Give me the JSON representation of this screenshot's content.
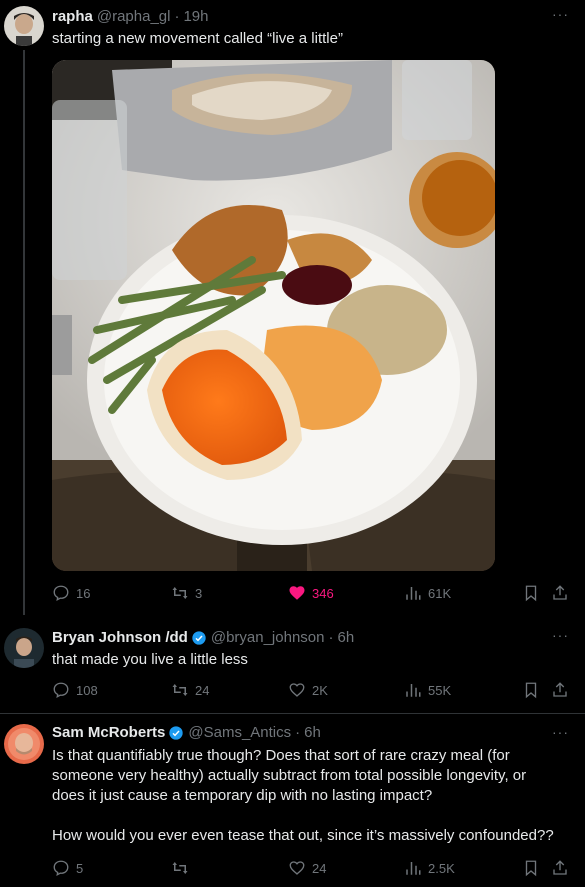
{
  "tweets": [
    {
      "name": "rapha",
      "handle": "@rapha_gl",
      "time": "19h",
      "text": "starting a new movement called “live a little”",
      "stats": {
        "replies": "16",
        "retweets": "3",
        "likes": "346",
        "views": "61K"
      },
      "liked": true
    },
    {
      "name": "Bryan Johnson /dd",
      "handle": "@bryan_johnson",
      "time": "6h",
      "text": "that made you live a little less",
      "stats": {
        "replies": "108",
        "retweets": "24",
        "likes": "2K",
        "views": "55K"
      },
      "verified": true
    },
    {
      "name": "Sam McRoberts",
      "handle": "@Sams_Antics",
      "time": "6h",
      "text1": "Is that quantifiably true though? Does that sort of rare crazy meal (for someone very healthy) actually subtract from total possible longevity, or does it just cause a temporary dip with no lasting impact?",
      "text2": "How would you ever even tease that out, since it’s massively confounded??",
      "stats": {
        "replies": "5",
        "retweets": "",
        "likes": "24",
        "views": "2.5K"
      },
      "verified": true
    }
  ],
  "ui": {
    "more": "···",
    "separator": "·"
  },
  "colors": {
    "background": "#000000",
    "text": "#e7e9ea",
    "muted": "#71767b",
    "like": "#f91880",
    "verified": "#1d9bf0"
  }
}
